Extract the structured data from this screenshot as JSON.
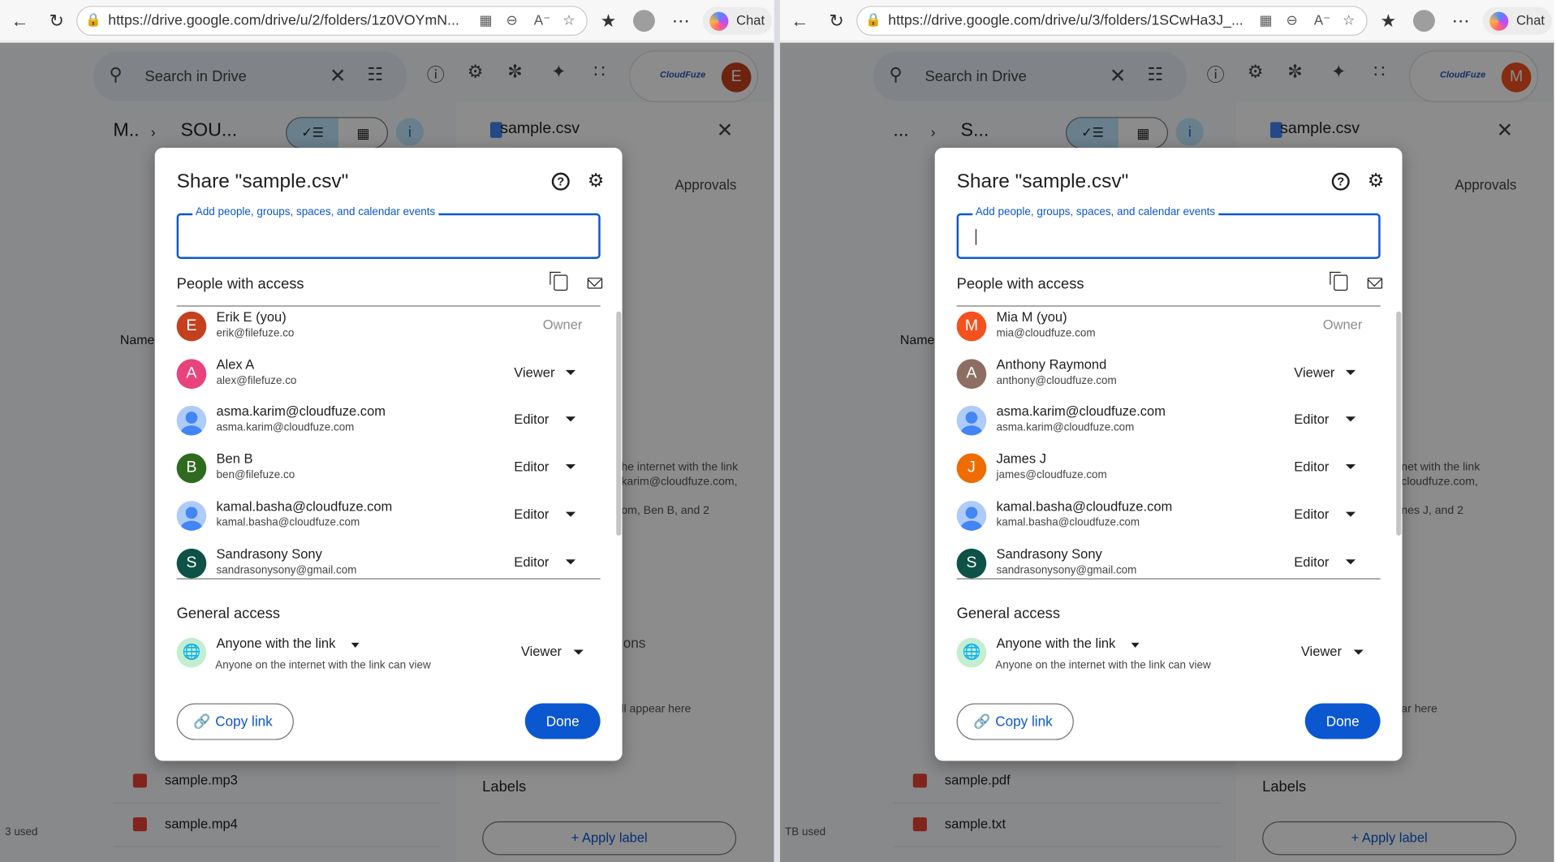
{
  "left": {
    "browser": {
      "url": "https://drive.google.com/drive/u/2/folders/1z0VOYmN...",
      "chat_label": "Chat"
    },
    "drive": {
      "search_placeholder": "Search in Drive",
      "account_initial": "E",
      "account_color": "#c5401e",
      "account_logo": "CloudFuze",
      "breadcrumb_root": "M..",
      "breadcrumb_folder": "SOU...",
      "side_file": "sample.csv",
      "side_tab": "Approvals",
      "side_sharing_lines": [
        "he internet with the link",
        "karim@cloudfuze.com,",
        "om, Ben B, and 2"
      ],
      "side_activity_text": "ons",
      "side_appear_text": "ll appear here",
      "labels": "Labels",
      "apply_label": "Apply label",
      "list_header": "Name",
      "files": [
        {
          "name": "sample.mp3"
        },
        {
          "name": "sample.mp4"
        }
      ],
      "storage": "3 used"
    },
    "dialog": {
      "title": "Share \"sample.csv\"",
      "input_label": "Add people, groups, spaces, and calendar events",
      "people_heading": "People with access",
      "people": [
        {
          "initial": "E",
          "name": "Erik E (you)",
          "email": "erik@filefuze.co",
          "role": "Owner",
          "color": "#c5401e"
        },
        {
          "initial": "A",
          "name": "Alex A",
          "email": "alex@filefuze.co",
          "role": "Viewer",
          "color": "#e8437c"
        },
        {
          "initial": "",
          "name": "asma.karim@cloudfuze.com",
          "email": "asma.karim@cloudfuze.com",
          "role": "Editor",
          "color": ""
        },
        {
          "initial": "B",
          "name": "Ben B",
          "email": "ben@filefuze.co",
          "role": "Editor",
          "color": "#2e6b1f"
        },
        {
          "initial": "",
          "name": "kamal.basha@cloudfuze.com",
          "email": "kamal.basha@cloudfuze.com",
          "role": "Editor",
          "color": ""
        },
        {
          "initial": "S",
          "name": "Sandrasony Sony",
          "email": "sandrasonysony@gmail.com",
          "role": "Editor",
          "color": "#0d5147"
        }
      ],
      "general_access": "General access",
      "access_type": "Anyone with the link",
      "access_desc": "Anyone on the internet with the link can view",
      "access_role": "Viewer",
      "copy_link": "Copy link",
      "done": "Done"
    }
  },
  "right": {
    "browser": {
      "url": "https://drive.google.com/drive/u/3/folders/1SCwHa3J_...",
      "chat_label": "Chat"
    },
    "drive": {
      "search_placeholder": "Search in Drive",
      "account_initial": "M",
      "account_color": "#f4511e",
      "account_logo": "CloudFuze",
      "breadcrumb_root": "...",
      "breadcrumb_folder": "S...",
      "side_file": "sample.csv",
      "side_tab": "Approvals",
      "side_sharing_lines": [
        "net with the link",
        "cloudfuze.com,",
        "nes J, and 2"
      ],
      "side_activity_text": "",
      "side_appear_text": "ar here",
      "labels": "Labels",
      "apply_label": "Apply label",
      "list_header": "Name",
      "files": [
        {
          "name": "sample.pdf"
        },
        {
          "name": "sample.txt"
        }
      ],
      "storage": "TB used"
    },
    "dialog": {
      "title": "Share \"sample.csv\"",
      "input_label": "Add people, groups, spaces, and calendar events",
      "people_heading": "People with access",
      "people": [
        {
          "initial": "M",
          "name": "Mia M (you)",
          "email": "mia@cloudfuze.com",
          "role": "Owner",
          "color": "#f4511e"
        },
        {
          "initial": "A",
          "name": "Anthony Raymond",
          "email": "anthony@cloudfuze.com",
          "role": "Viewer",
          "color": "#8d6e63"
        },
        {
          "initial": "",
          "name": "asma.karim@cloudfuze.com",
          "email": "asma.karim@cloudfuze.com",
          "role": "Editor",
          "color": ""
        },
        {
          "initial": "J",
          "name": "James J",
          "email": "james@cloudfuze.com",
          "role": "Editor",
          "color": "#ef6c00"
        },
        {
          "initial": "",
          "name": "kamal.basha@cloudfuze.com",
          "email": "kamal.basha@cloudfuze.com",
          "role": "Editor",
          "color": ""
        },
        {
          "initial": "S",
          "name": "Sandrasony Sony",
          "email": "sandrasonysony@gmail.com",
          "role": "Editor",
          "color": "#0d5147"
        }
      ],
      "general_access": "General access",
      "access_type": "Anyone with the link",
      "access_desc": "Anyone on the internet with the link can view",
      "access_role": "Viewer",
      "copy_link": "Copy link",
      "done": "Done"
    }
  },
  "colors": {
    "primary": "#0b57d0",
    "input_border": "#0b57d0",
    "chip_bg": "#c2e7ff"
  }
}
